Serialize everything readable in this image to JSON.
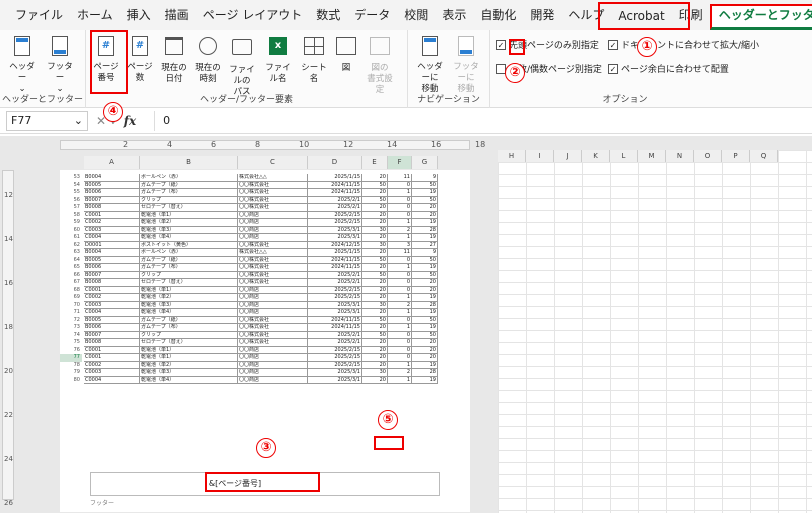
{
  "menu": [
    "ファイル",
    "ホーム",
    "挿入",
    "描画",
    "ページ レイアウト",
    "数式",
    "データ",
    "校閲",
    "表示",
    "自動化",
    "開発",
    "ヘルプ",
    "Acrobat",
    "印刷",
    "ヘッダーとフッター"
  ],
  "ribbon": {
    "group_hf": {
      "header": "ヘッダー",
      "footer": "フッター",
      "label": "ヘッダーとフッター"
    },
    "group_elements": {
      "page_number": "ページ\n番号",
      "page_count": "ページ数",
      "current_date": "現在の\n日付",
      "current_time": "現在の\n時刻",
      "file_path": "ファイルの\nパス",
      "file_name": "ファイル名",
      "sheet_name": "シート名",
      "picture": "図",
      "format_picture": "図の\n書式設定",
      "label": "ヘッダー/フッター要素"
    },
    "group_nav": {
      "goto_header": "ヘッダーに\n移動",
      "goto_footer": "フッターに\n移動",
      "label": "ナビゲーション"
    },
    "group_options": {
      "first_page": "先頭ページのみ別指定",
      "odd_even": "奇数/偶数ページ別指定",
      "scale": "ドキュメントに合わせて拡大/縮小",
      "align": "ページ余白に合わせて配置",
      "label": "オプション"
    }
  },
  "callouts": [
    "①",
    "②",
    "③",
    "④",
    "⑤"
  ],
  "formula": {
    "cell": "F77",
    "value": "0",
    "fx": "fx"
  },
  "hruler_ticks": [
    "2",
    "4",
    "6",
    "8",
    "10",
    "12",
    "14",
    "16",
    "18"
  ],
  "vruler_ticks": [
    "12",
    "14",
    "16",
    "18",
    "20",
    "22",
    "24",
    "26"
  ],
  "column_headers": [
    "A",
    "B",
    "C",
    "D",
    "E",
    "F",
    "G"
  ],
  "right_columns": [
    "H",
    "I",
    "J",
    "K",
    "L",
    "M",
    "N",
    "O",
    "P",
    "Q"
  ],
  "rows": [
    {
      "n": "53",
      "a": "B0004",
      "b": "ボールペン（赤）",
      "c": "株式会社△△",
      "d": "2025/1/15",
      "e": "20",
      "f": "11",
      "g": "9"
    },
    {
      "n": "54",
      "a": "B0005",
      "b": "ガムテープ（紙）",
      "c": "〇〇株式会社",
      "d": "2024/11/15",
      "e": "50",
      "f": "0",
      "g": "50"
    },
    {
      "n": "55",
      "a": "B0006",
      "b": "ガムテープ（布）",
      "c": "〇〇株式会社",
      "d": "2024/11/15",
      "e": "20",
      "f": "1",
      "g": "19"
    },
    {
      "n": "56",
      "a": "B0007",
      "b": "クリップ",
      "c": "〇〇株式会社",
      "d": "2025/2/1",
      "e": "50",
      "f": "0",
      "g": "50"
    },
    {
      "n": "57",
      "a": "B0008",
      "b": "セロテープ（替え）",
      "c": "〇〇株式会社",
      "d": "2025/2/1",
      "e": "20",
      "f": "0",
      "g": "20"
    },
    {
      "n": "58",
      "a": "C0001",
      "b": "乾電池（単1）",
      "c": "〇〇商店",
      "d": "2025/2/15",
      "e": "20",
      "f": "0",
      "g": "20"
    },
    {
      "n": "59",
      "a": "C0002",
      "b": "乾電池（単2）",
      "c": "〇〇商店",
      "d": "2025/2/15",
      "e": "20",
      "f": "1",
      "g": "19"
    },
    {
      "n": "60",
      "a": "C0003",
      "b": "乾電池（単3）",
      "c": "〇〇商店",
      "d": "2025/3/1",
      "e": "30",
      "f": "2",
      "g": "28"
    },
    {
      "n": "61",
      "a": "C0004",
      "b": "乾電池（単4）",
      "c": "〇〇商店",
      "d": "2025/3/1",
      "e": "20",
      "f": "1",
      "g": "19"
    },
    {
      "n": "62",
      "a": "D0001",
      "b": "ポストイット（黄色）",
      "c": "〇〇株式会社",
      "d": "2024/12/15",
      "e": "30",
      "f": "3",
      "g": "27"
    },
    {
      "n": "63",
      "a": "B0004",
      "b": "ボールペン（赤）",
      "c": "株式会社△△",
      "d": "2025/1/15",
      "e": "20",
      "f": "11",
      "g": "9"
    },
    {
      "n": "64",
      "a": "B0005",
      "b": "ガムテープ（紙）",
      "c": "〇〇株式会社",
      "d": "2024/11/15",
      "e": "50",
      "f": "0",
      "g": "50"
    },
    {
      "n": "65",
      "a": "B0006",
      "b": "ガムテープ（布）",
      "c": "〇〇株式会社",
      "d": "2024/11/15",
      "e": "20",
      "f": "1",
      "g": "19"
    },
    {
      "n": "66",
      "a": "B0007",
      "b": "クリップ",
      "c": "〇〇株式会社",
      "d": "2025/2/1",
      "e": "50",
      "f": "0",
      "g": "50"
    },
    {
      "n": "67",
      "a": "B0008",
      "b": "セロテープ（替え）",
      "c": "〇〇株式会社",
      "d": "2025/2/1",
      "e": "20",
      "f": "0",
      "g": "20"
    },
    {
      "n": "68",
      "a": "C0001",
      "b": "乾電池（単1）",
      "c": "〇〇商店",
      "d": "2025/2/15",
      "e": "20",
      "f": "0",
      "g": "20"
    },
    {
      "n": "69",
      "a": "C0002",
      "b": "乾電池（単2）",
      "c": "〇〇商店",
      "d": "2025/2/15",
      "e": "20",
      "f": "1",
      "g": "19"
    },
    {
      "n": "70",
      "a": "C0003",
      "b": "乾電池（単3）",
      "c": "〇〇商店",
      "d": "2025/3/1",
      "e": "30",
      "f": "2",
      "g": "28"
    },
    {
      "n": "71",
      "a": "C0004",
      "b": "乾電池（単4）",
      "c": "〇〇商店",
      "d": "2025/3/1",
      "e": "20",
      "f": "1",
      "g": "19"
    },
    {
      "n": "72",
      "a": "B0005",
      "b": "ガムテープ（紙）",
      "c": "〇〇株式会社",
      "d": "2024/11/15",
      "e": "50",
      "f": "0",
      "g": "50"
    },
    {
      "n": "73",
      "a": "B0006",
      "b": "ガムテープ（布）",
      "c": "〇〇株式会社",
      "d": "2024/11/15",
      "e": "20",
      "f": "1",
      "g": "19"
    },
    {
      "n": "74",
      "a": "B0007",
      "b": "クリップ",
      "c": "〇〇株式会社",
      "d": "2025/2/1",
      "e": "50",
      "f": "0",
      "g": "50"
    },
    {
      "n": "75",
      "a": "B0008",
      "b": "セロテープ（替え）",
      "c": "〇〇株式会社",
      "d": "2025/2/1",
      "e": "20",
      "f": "0",
      "g": "20"
    },
    {
      "n": "76",
      "a": "C0001",
      "b": "乾電池（単1）",
      "c": "〇〇商店",
      "d": "2025/2/15",
      "e": "20",
      "f": "0",
      "g": "20"
    },
    {
      "n": "77",
      "a": "C0001",
      "b": "乾電池（単1）",
      "c": "〇〇商店",
      "d": "2025/2/15",
      "e": "20",
      "f": "0",
      "g": "20"
    },
    {
      "n": "78",
      "a": "C0002",
      "b": "乾電池（単2）",
      "c": "〇〇商店",
      "d": "2025/2/15",
      "e": "20",
      "f": "1",
      "g": "19"
    },
    {
      "n": "79",
      "a": "C0003",
      "b": "乾電池（単3）",
      "c": "〇〇商店",
      "d": "2025/3/1",
      "e": "30",
      "f": "2",
      "g": "28"
    },
    {
      "n": "80",
      "a": "C0004",
      "b": "乾電池（単4）",
      "c": "〇〇商店",
      "d": "2025/3/1",
      "e": "20",
      "f": "1",
      "g": "19"
    }
  ],
  "selected_row": "77",
  "footer": {
    "text": "&[ページ番号]",
    "label": "フッター"
  },
  "colors": {
    "accent": "#107c41",
    "highlight": "#e00000"
  }
}
